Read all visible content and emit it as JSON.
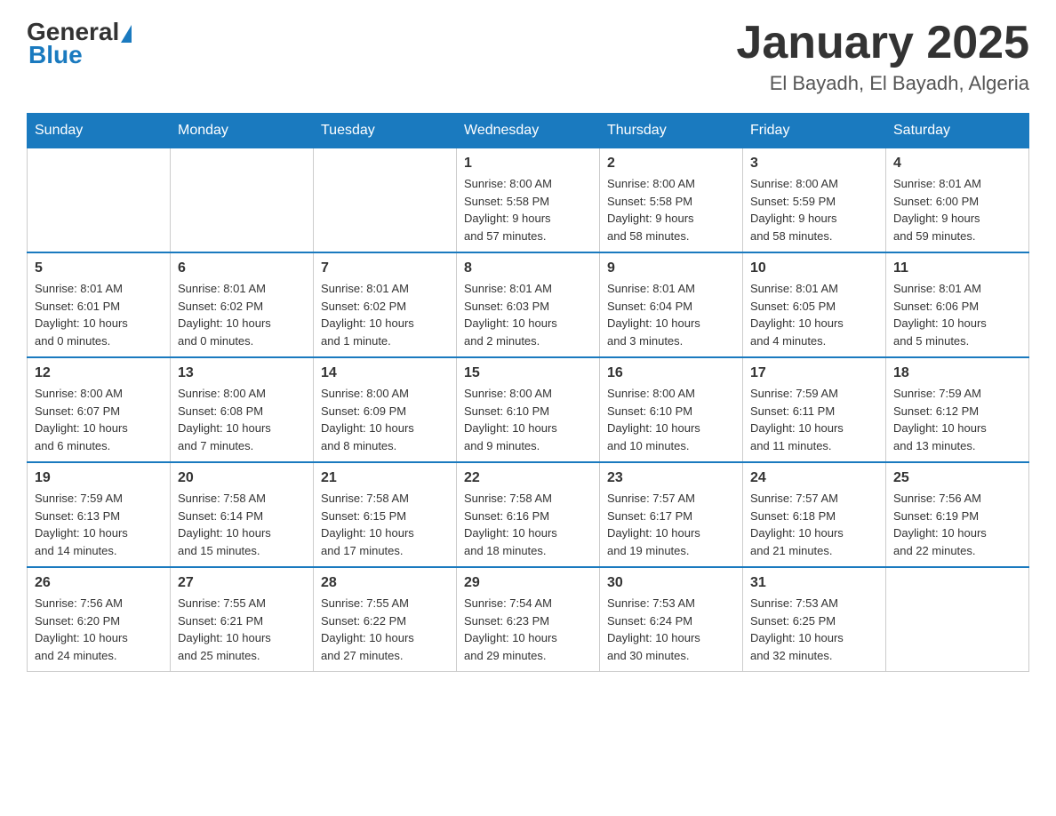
{
  "header": {
    "logo": {
      "general": "General",
      "blue": "Blue"
    },
    "title": "January 2025",
    "subtitle": "El Bayadh, El Bayadh, Algeria"
  },
  "days_of_week": [
    "Sunday",
    "Monday",
    "Tuesday",
    "Wednesday",
    "Thursday",
    "Friday",
    "Saturday"
  ],
  "weeks": [
    [
      {
        "day": "",
        "info": ""
      },
      {
        "day": "",
        "info": ""
      },
      {
        "day": "",
        "info": ""
      },
      {
        "day": "1",
        "info": "Sunrise: 8:00 AM\nSunset: 5:58 PM\nDaylight: 9 hours\nand 57 minutes."
      },
      {
        "day": "2",
        "info": "Sunrise: 8:00 AM\nSunset: 5:58 PM\nDaylight: 9 hours\nand 58 minutes."
      },
      {
        "day": "3",
        "info": "Sunrise: 8:00 AM\nSunset: 5:59 PM\nDaylight: 9 hours\nand 58 minutes."
      },
      {
        "day": "4",
        "info": "Sunrise: 8:01 AM\nSunset: 6:00 PM\nDaylight: 9 hours\nand 59 minutes."
      }
    ],
    [
      {
        "day": "5",
        "info": "Sunrise: 8:01 AM\nSunset: 6:01 PM\nDaylight: 10 hours\nand 0 minutes."
      },
      {
        "day": "6",
        "info": "Sunrise: 8:01 AM\nSunset: 6:02 PM\nDaylight: 10 hours\nand 0 minutes."
      },
      {
        "day": "7",
        "info": "Sunrise: 8:01 AM\nSunset: 6:02 PM\nDaylight: 10 hours\nand 1 minute."
      },
      {
        "day": "8",
        "info": "Sunrise: 8:01 AM\nSunset: 6:03 PM\nDaylight: 10 hours\nand 2 minutes."
      },
      {
        "day": "9",
        "info": "Sunrise: 8:01 AM\nSunset: 6:04 PM\nDaylight: 10 hours\nand 3 minutes."
      },
      {
        "day": "10",
        "info": "Sunrise: 8:01 AM\nSunset: 6:05 PM\nDaylight: 10 hours\nand 4 minutes."
      },
      {
        "day": "11",
        "info": "Sunrise: 8:01 AM\nSunset: 6:06 PM\nDaylight: 10 hours\nand 5 minutes."
      }
    ],
    [
      {
        "day": "12",
        "info": "Sunrise: 8:00 AM\nSunset: 6:07 PM\nDaylight: 10 hours\nand 6 minutes."
      },
      {
        "day": "13",
        "info": "Sunrise: 8:00 AM\nSunset: 6:08 PM\nDaylight: 10 hours\nand 7 minutes."
      },
      {
        "day": "14",
        "info": "Sunrise: 8:00 AM\nSunset: 6:09 PM\nDaylight: 10 hours\nand 8 minutes."
      },
      {
        "day": "15",
        "info": "Sunrise: 8:00 AM\nSunset: 6:10 PM\nDaylight: 10 hours\nand 9 minutes."
      },
      {
        "day": "16",
        "info": "Sunrise: 8:00 AM\nSunset: 6:10 PM\nDaylight: 10 hours\nand 10 minutes."
      },
      {
        "day": "17",
        "info": "Sunrise: 7:59 AM\nSunset: 6:11 PM\nDaylight: 10 hours\nand 11 minutes."
      },
      {
        "day": "18",
        "info": "Sunrise: 7:59 AM\nSunset: 6:12 PM\nDaylight: 10 hours\nand 13 minutes."
      }
    ],
    [
      {
        "day": "19",
        "info": "Sunrise: 7:59 AM\nSunset: 6:13 PM\nDaylight: 10 hours\nand 14 minutes."
      },
      {
        "day": "20",
        "info": "Sunrise: 7:58 AM\nSunset: 6:14 PM\nDaylight: 10 hours\nand 15 minutes."
      },
      {
        "day": "21",
        "info": "Sunrise: 7:58 AM\nSunset: 6:15 PM\nDaylight: 10 hours\nand 17 minutes."
      },
      {
        "day": "22",
        "info": "Sunrise: 7:58 AM\nSunset: 6:16 PM\nDaylight: 10 hours\nand 18 minutes."
      },
      {
        "day": "23",
        "info": "Sunrise: 7:57 AM\nSunset: 6:17 PM\nDaylight: 10 hours\nand 19 minutes."
      },
      {
        "day": "24",
        "info": "Sunrise: 7:57 AM\nSunset: 6:18 PM\nDaylight: 10 hours\nand 21 minutes."
      },
      {
        "day": "25",
        "info": "Sunrise: 7:56 AM\nSunset: 6:19 PM\nDaylight: 10 hours\nand 22 minutes."
      }
    ],
    [
      {
        "day": "26",
        "info": "Sunrise: 7:56 AM\nSunset: 6:20 PM\nDaylight: 10 hours\nand 24 minutes."
      },
      {
        "day": "27",
        "info": "Sunrise: 7:55 AM\nSunset: 6:21 PM\nDaylight: 10 hours\nand 25 minutes."
      },
      {
        "day": "28",
        "info": "Sunrise: 7:55 AM\nSunset: 6:22 PM\nDaylight: 10 hours\nand 27 minutes."
      },
      {
        "day": "29",
        "info": "Sunrise: 7:54 AM\nSunset: 6:23 PM\nDaylight: 10 hours\nand 29 minutes."
      },
      {
        "day": "30",
        "info": "Sunrise: 7:53 AM\nSunset: 6:24 PM\nDaylight: 10 hours\nand 30 minutes."
      },
      {
        "day": "31",
        "info": "Sunrise: 7:53 AM\nSunset: 6:25 PM\nDaylight: 10 hours\nand 32 minutes."
      },
      {
        "day": "",
        "info": ""
      }
    ]
  ]
}
